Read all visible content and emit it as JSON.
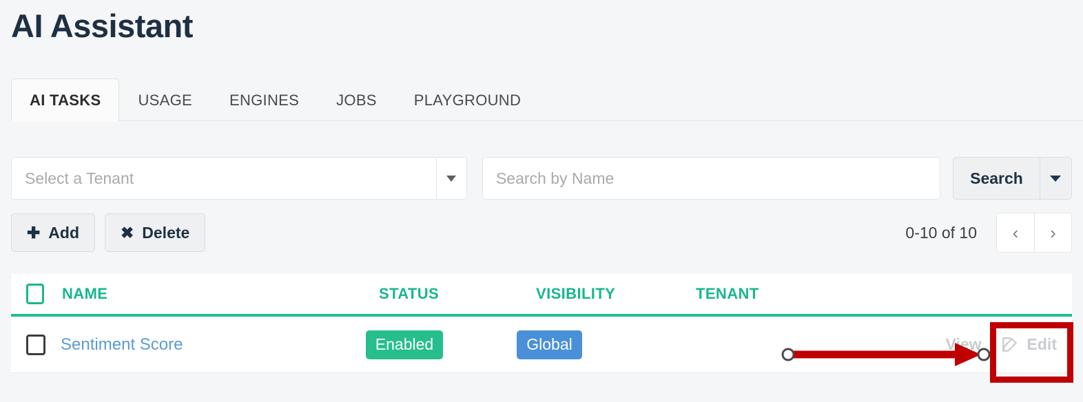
{
  "header": {
    "title": "AI Assistant"
  },
  "tabs": [
    {
      "label": "AI TASKS",
      "active": true
    },
    {
      "label": "USAGE",
      "active": false
    },
    {
      "label": "ENGINES",
      "active": false
    },
    {
      "label": "JOBS",
      "active": false
    },
    {
      "label": "PLAYGROUND",
      "active": false
    }
  ],
  "filters": {
    "tenant_select": {
      "value": "Select a Tenant",
      "caret_icon": "caret-down-icon"
    },
    "search_input": {
      "value": "",
      "placeholder": "Search by Name"
    },
    "search_button": {
      "label": "Search",
      "caret_icon": "caret-down-icon"
    }
  },
  "toolbar": {
    "add_label": "Add",
    "add_glyph": "✚",
    "delete_label": "Delete",
    "delete_glyph": "✖"
  },
  "pagination": {
    "range_label": "0-10 of 10",
    "prev_glyph": "‹",
    "next_glyph": "›"
  },
  "table": {
    "columns": [
      "NAME",
      "STATUS",
      "VISIBILITY",
      "TENANT"
    ],
    "rows": [
      {
        "name": "Sentiment Score",
        "status": "Enabled",
        "visibility": "Global",
        "tenant": "",
        "view_label": "View",
        "edit_label": "Edit",
        "edit_icon": "pencil-square-icon"
      }
    ]
  },
  "colors": {
    "accent_teal": "#18b78d",
    "status_enabled": "#26be8c",
    "visibility_global": "#4a90d9",
    "link_blue": "#5b9bd5",
    "annotation_red": "#c00000",
    "title_navy": "#1f3044"
  },
  "annotation": {
    "arrow": "red-arrow",
    "highlight_box": "red-highlight-rectangle"
  }
}
